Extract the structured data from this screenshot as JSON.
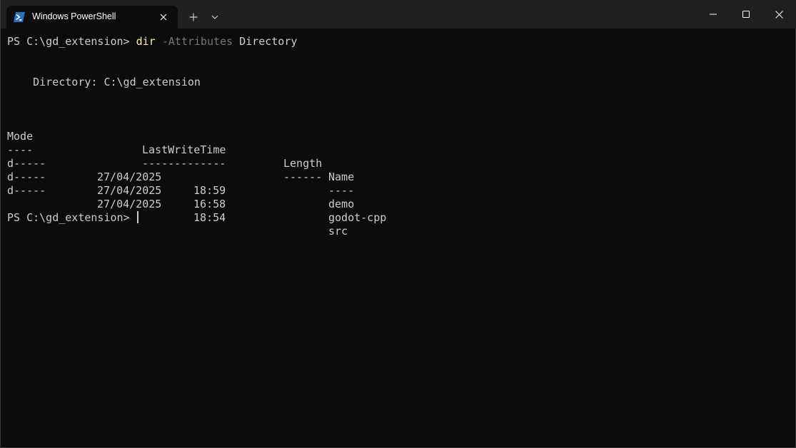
{
  "window": {
    "tab_title": "Windows PowerShell",
    "tab_icon": "powershell-icon",
    "new_tab_icon": "plus-icon",
    "dropdown_icon": "chevron-down-icon",
    "minimize_icon": "minimize-icon",
    "maximize_icon": "maximize-icon",
    "close_icon": "close-icon"
  },
  "terminal": {
    "prompt1": "PS C:\\gd_extension> ",
    "command": "dir",
    "param": " -Attributes",
    "arg": " Directory",
    "directory_line": "    Directory: C:\\gd_extension",
    "headers": {
      "mode": "Mode",
      "lastwritetime": "LastWriteTime",
      "length": "Length",
      "name": "Name"
    },
    "underlines": {
      "mode": "----",
      "lastwritetime": "-------------",
      "length": "------",
      "name": "----"
    },
    "rows": [
      {
        "mode": "d-----",
        "date": "27/04/2025",
        "time": "18:59",
        "name": "demo"
      },
      {
        "mode": "d-----",
        "date": "27/04/2025",
        "time": "16:58",
        "name": "godot-cpp"
      },
      {
        "mode": "d-----",
        "date": "27/04/2025",
        "time": "18:54",
        "name": "src"
      }
    ],
    "prompt2": "PS C:\\gd_extension> "
  },
  "colors": {
    "background": "#0c0c0c",
    "titlebar": "#202020",
    "foreground": "#cccccc",
    "command": "#f9f1a5",
    "parameter": "#767676"
  }
}
